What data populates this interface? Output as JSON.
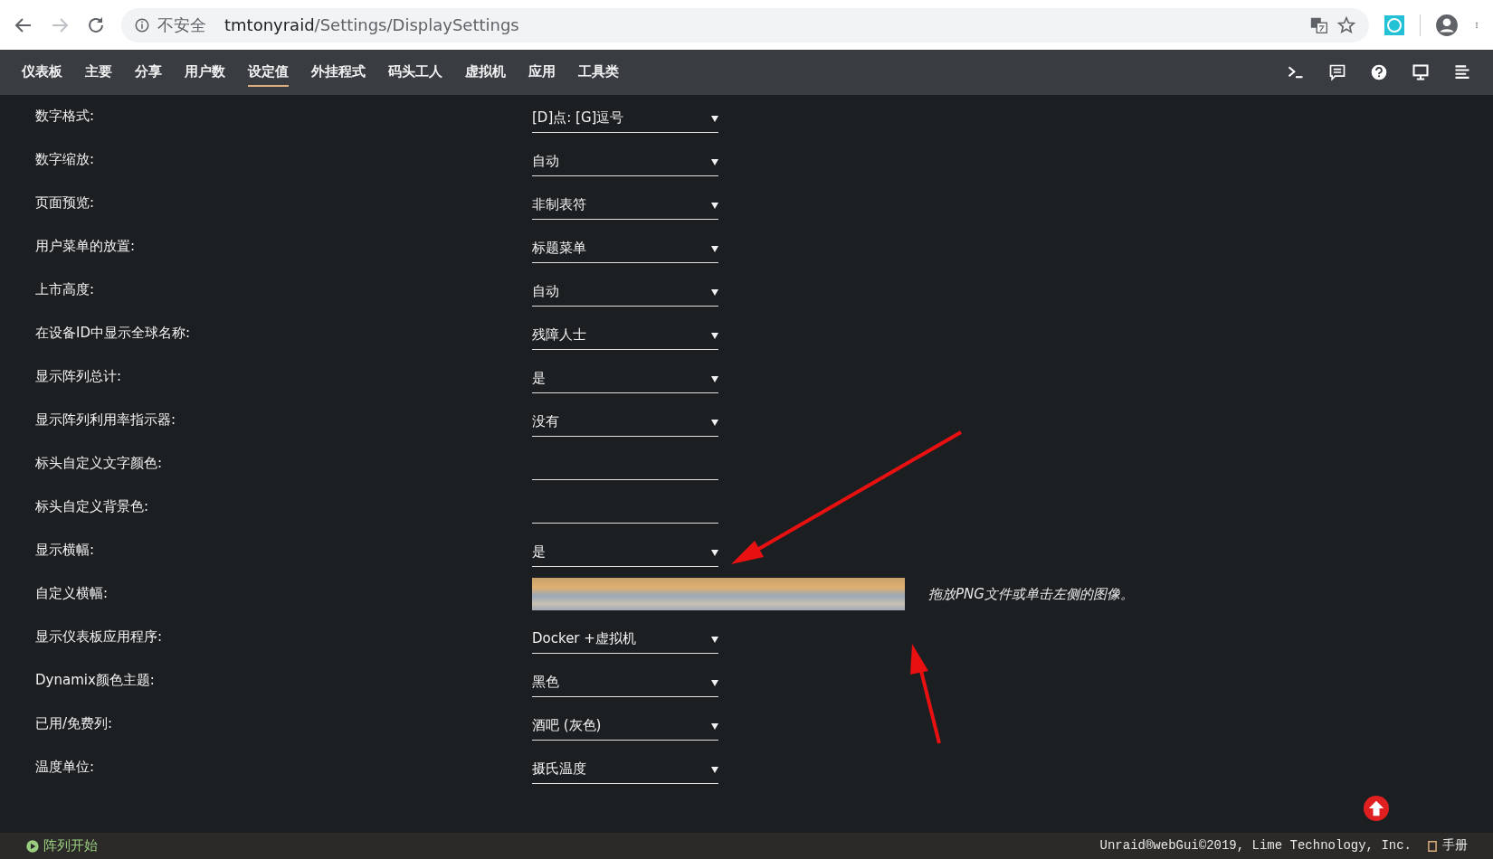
{
  "browser": {
    "security_label": "不安全",
    "url_host": "tmtonyraid",
    "url_path": "/Settings/DisplaySettings"
  },
  "nav": {
    "items": [
      {
        "label": "仪表板",
        "selected": false
      },
      {
        "label": "主要",
        "selected": false
      },
      {
        "label": "分享",
        "selected": false
      },
      {
        "label": "用户数",
        "selected": false
      },
      {
        "label": "设定值",
        "selected": true
      },
      {
        "label": "外挂程式",
        "selected": false
      },
      {
        "label": "码头工人",
        "selected": false
      },
      {
        "label": "虚拟机",
        "selected": false
      },
      {
        "label": "应用",
        "selected": false
      },
      {
        "label": "工具类",
        "selected": false
      }
    ]
  },
  "settings": [
    {
      "label": "数字格式:",
      "kind": "select",
      "value": "[D]点: [G]逗号"
    },
    {
      "label": "数字缩放:",
      "kind": "select",
      "value": "自动"
    },
    {
      "label": "页面预览:",
      "kind": "select",
      "value": "非制表符"
    },
    {
      "label": "用户菜单的放置:",
      "kind": "select",
      "value": "标题菜单"
    },
    {
      "label": "上市高度:",
      "kind": "select",
      "value": "自动"
    },
    {
      "label": "在设备ID中显示全球名称:",
      "kind": "select",
      "value": "残障人士"
    },
    {
      "label": "显示阵列总计:",
      "kind": "select",
      "value": "是"
    },
    {
      "label": "显示阵列利用率指示器:",
      "kind": "select",
      "value": "没有"
    },
    {
      "label": "标头自定义文字颜色:",
      "kind": "text"
    },
    {
      "label": "标头自定义背景色:",
      "kind": "text"
    },
    {
      "label": "显示横幅:",
      "kind": "select",
      "value": "是"
    },
    {
      "label": "自定义横幅:",
      "kind": "image",
      "hint": "拖放PNG文件或单击左侧的图像。"
    },
    {
      "label": "显示仪表板应用程序:",
      "kind": "select",
      "value": "Docker +虚拟机"
    },
    {
      "label": "Dynamix颜色主题:",
      "kind": "select",
      "value": "黑色"
    },
    {
      "label": "已用/免费列:",
      "kind": "select",
      "value": "酒吧 (灰色)"
    },
    {
      "label": "温度单位:",
      "kind": "select",
      "value": "摄氏温度"
    }
  ],
  "footer": {
    "array_status": "阵列开始",
    "copyright": "Unraid®webGui©2019, Lime Technology, Inc.",
    "manual": "手册"
  }
}
